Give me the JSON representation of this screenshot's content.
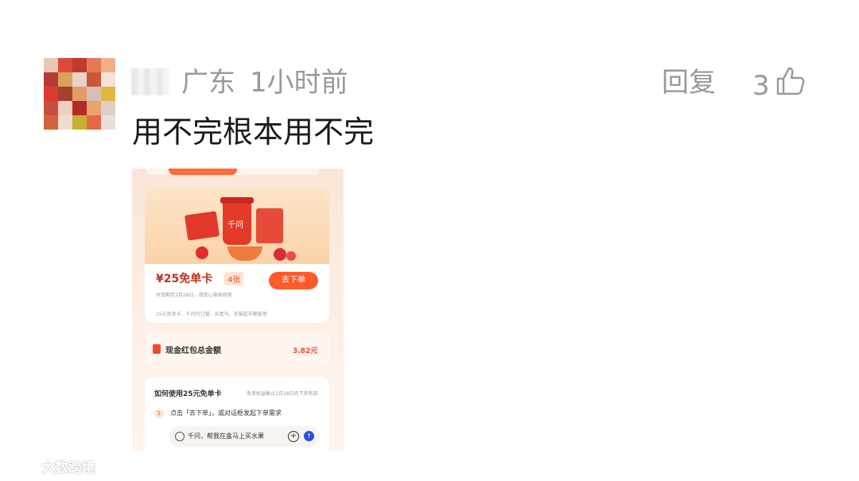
{
  "comment": {
    "location": "广东",
    "time": "1小时前",
    "reply_label": "回复",
    "like_count": "3",
    "text": "用不完根本用不完"
  },
  "screenshot": {
    "coupon": {
      "price_label": "¥25免单卡",
      "count_badge": "4张",
      "validity": "有效期至2月28日，请放心继续使用",
      "order_button": "去下单",
      "note": "25元免单卡，千问内订餐、买盒马、天猫超市都能用",
      "cup_logo": "千问"
    },
    "cash": {
      "label": "现金红包总金额",
      "amount": "3.82元"
    },
    "howto": {
      "heading": "如何使用25元免单卡",
      "deadline": "免单权益截止2月28日内下单有效",
      "step_number": "1",
      "step_text": "点击「去下单」，或对话框发起下单需求",
      "input_text": "千问，帮我在盒马上买水果"
    }
  },
  "watermark": {
    "text": "大数跨境"
  },
  "colors": {
    "meta_gray": "#999999",
    "accent_orange": "#ff5a2a",
    "send_blue": "#2b4de0"
  }
}
